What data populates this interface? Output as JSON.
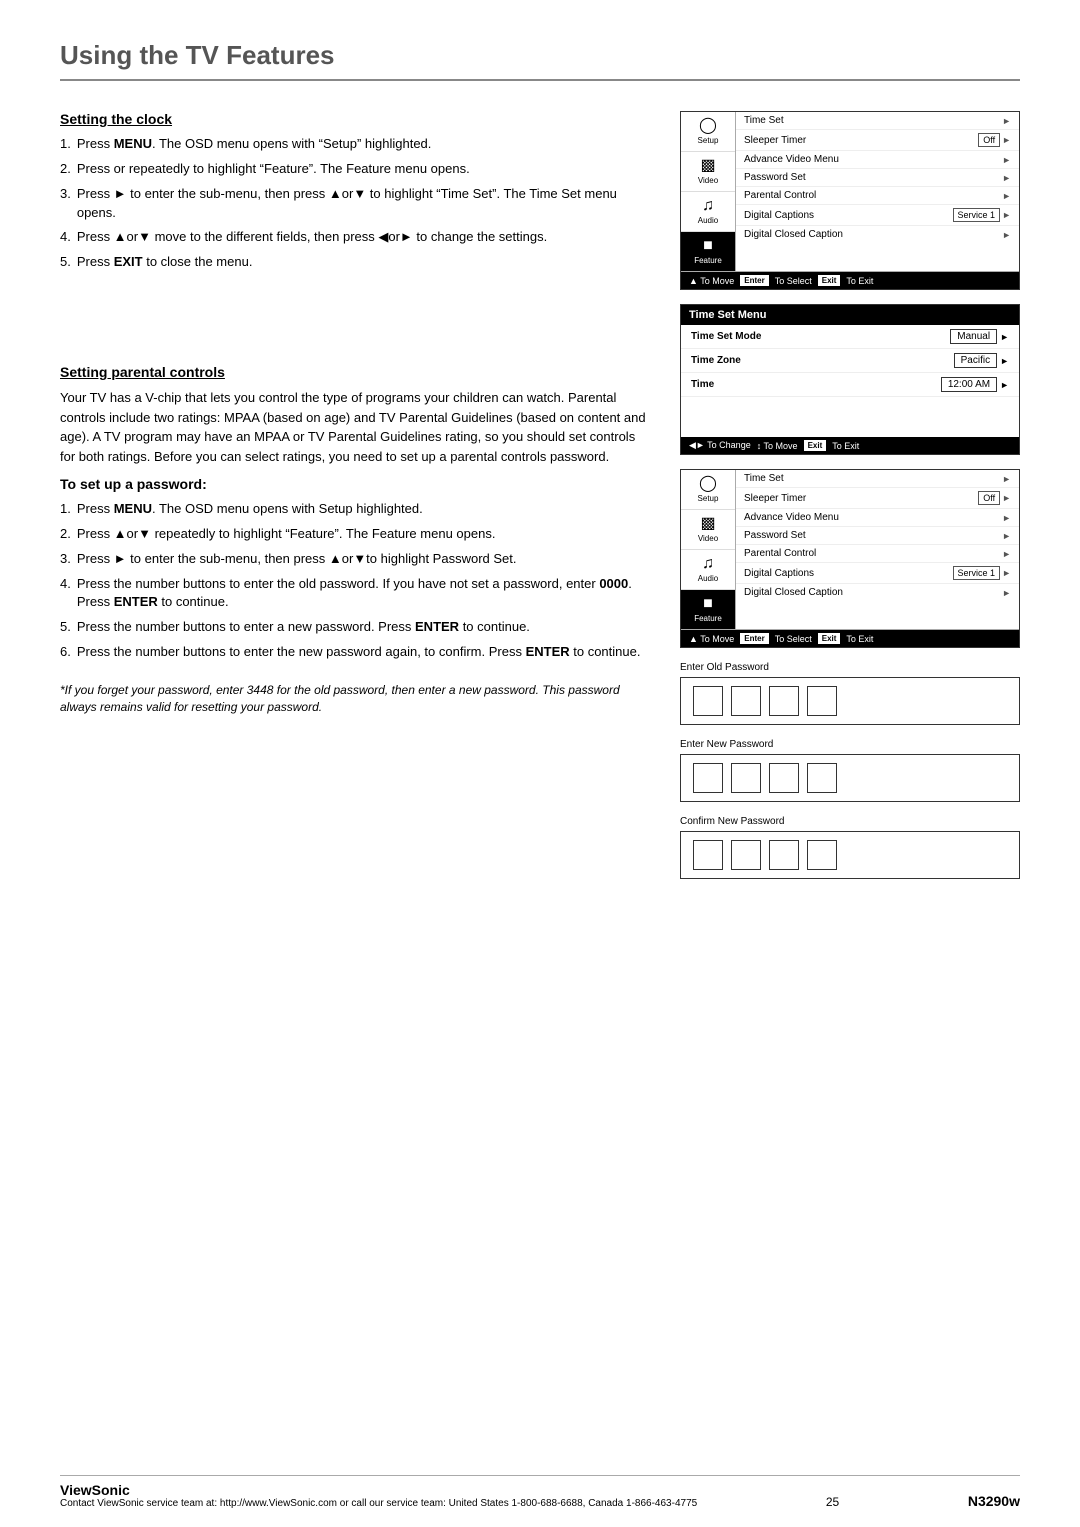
{
  "page": {
    "title": "Using the TV Features",
    "footer": {
      "contact": "Contact ViewSonic service team at: http://www.ViewSonic.com or call our service team: United States 1-800-688-6688, Canada 1-866-463-4775",
      "brand": "ViewSonic",
      "page_number": "25",
      "model": "N3290w"
    }
  },
  "section1": {
    "heading": "Setting the clock",
    "steps": [
      {
        "num": "1.",
        "text_before": "Press ",
        "bold": "MENU",
        "text_after": ". The OSD menu opens with “Setup” highlighted."
      },
      {
        "num": "2.",
        "text_before": "Press or repeatedly to highlight “Feature”. The Feature menu opens.",
        "bold": "",
        "text_after": ""
      },
      {
        "num": "3.",
        "text_before": "Press ► to enter the sub-menu, then press ▲or▼ to highlight “Time Set”. The Time Set menu opens.",
        "bold": "",
        "text_after": ""
      },
      {
        "num": "4.",
        "text_before": "Press ▲or▼ move to the different fields, then press ◄or► to change the settings.",
        "bold": "",
        "text_after": ""
      },
      {
        "num": "5.",
        "text_before": "Press ",
        "bold": "EXIT",
        "text_after": " to close the menu."
      }
    ]
  },
  "osd_menu": {
    "icons": [
      {
        "symbol": "⊙",
        "label": "Setup"
      },
      {
        "symbol": "▐",
        "label": "Video"
      },
      {
        "symbol": "♪",
        "label": "Audio"
      },
      {
        "symbol": "▣",
        "label": "Feature"
      }
    ],
    "rows": [
      {
        "label": "Time Set",
        "value": "",
        "arrow": true
      },
      {
        "label": "Sleeper Timer",
        "value": "Off",
        "arrow": true
      },
      {
        "label": "Advance Video Menu",
        "value": "",
        "arrow": true
      },
      {
        "label": "Password Set",
        "value": "",
        "arrow": true
      },
      {
        "label": "Parental Control",
        "value": "",
        "arrow": true
      },
      {
        "label": "Digital Captions",
        "value": "Service 1",
        "arrow": true
      },
      {
        "label": "Digital Closed Caption",
        "value": "",
        "arrow": true
      }
    ],
    "nav": "← To Move   Enter To Select   Exit  To Exit"
  },
  "time_set_menu": {
    "title": "Time Set Menu",
    "rows": [
      {
        "label": "Time Set Mode",
        "value": "Manual"
      },
      {
        "label": "Time Zone",
        "value": "Pacific"
      },
      {
        "label": "Time",
        "value": "12:00 AM"
      }
    ],
    "nav": "◄► To Change   ↕ To Move   Exit  To Exit"
  },
  "section2": {
    "heading": "Setting parental controls",
    "intro": "Your TV has a V-chip that lets you control the type of programs your children can watch. Parental controls include two ratings: MPAA (based on age) and TV Parental Guidelines (based on content and age). A TV program may have an MPAA or TV Parental Guidelines rating, so you should set controls for both ratings. Before you can select ratings, you need to set up a parental controls password.",
    "sub_heading": "To set up a password:",
    "steps": [
      {
        "num": "1.",
        "text_before": "Press ",
        "bold": "MENU",
        "text_after": ". The OSD menu opens with Setup highlighted."
      },
      {
        "num": "2.",
        "text_before": "Press ▲or▼ repeatedly to highlight “Feature”. The Feature menu opens.",
        "bold": "",
        "text_after": ""
      },
      {
        "num": "3.",
        "text_before": "Press ► to enter the sub-menu, then press ▲or▼to highlight Password Set.",
        "bold": "",
        "text_after": ""
      },
      {
        "num": "4.",
        "text_before": "Press the number buttons to enter the old password. If you have not set a password, enter ",
        "bold": "0000",
        "text_after": ". Press ",
        "bold2": "ENTER",
        "text_after2": " to continue."
      },
      {
        "num": "5.",
        "text_before": "Press the number buttons to enter a new password. Press ",
        "bold": "ENTER",
        "text_after": " to continue."
      },
      {
        "num": "6.",
        "text_before": "Press the number buttons to enter the new password again, to confirm. Press ",
        "bold": "ENTER",
        "text_after": " to continue."
      }
    ],
    "italic": "*If you forget your password, enter 3448 for the old password, then enter a new password. This password always remains valid for resetting your password."
  },
  "password_inputs": [
    {
      "label": "Enter Old Password"
    },
    {
      "label": "Enter New Password"
    },
    {
      "label": "Confirm New Password"
    }
  ]
}
